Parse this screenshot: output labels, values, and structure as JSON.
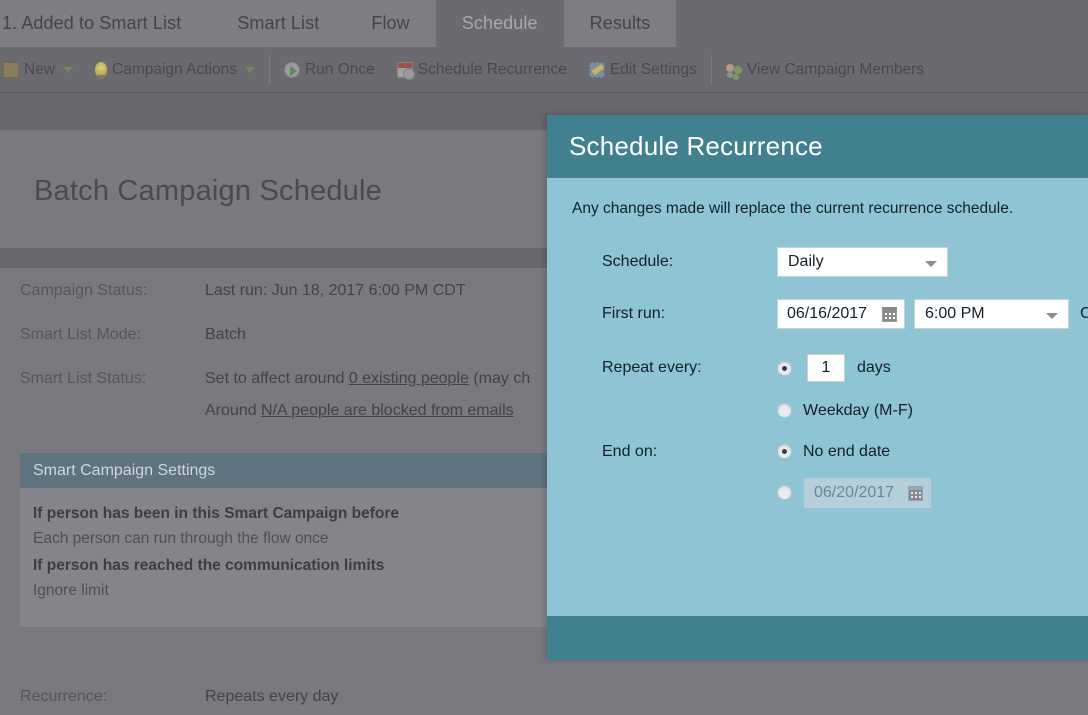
{
  "tabs": [
    {
      "label": "1. Added to Smart List",
      "active": false
    },
    {
      "label": "Smart List",
      "active": false
    },
    {
      "label": "Flow",
      "active": false
    },
    {
      "label": "Schedule",
      "active": true
    },
    {
      "label": "Results",
      "active": false
    }
  ],
  "toolbar": {
    "new_label": "New",
    "campaign_actions_label": "Campaign Actions",
    "run_once_label": "Run Once",
    "schedule_recurrence_label": "Schedule Recurrence",
    "edit_settings_label": "Edit Settings",
    "view_campaign_members_label": "View Campaign Members"
  },
  "page": {
    "title": "Batch Campaign Schedule",
    "rows": [
      {
        "label": "Campaign Status:",
        "value": "Last run: Jun 18, 2017 6:00 PM CDT"
      },
      {
        "label": "Smart List Mode:",
        "value": "Batch"
      }
    ],
    "smart_list_status": {
      "label": "Smart List Status:",
      "prefix": "Set to affect around ",
      "link": "0 existing people",
      "suffix": " (may ch",
      "sub_prefix": "Around ",
      "sub_link": "N/A people are blocked from emails"
    },
    "settings_panel": {
      "header": "Smart Campaign Settings",
      "items": [
        {
          "text": "If person has been in this Smart Campaign before",
          "bold": true
        },
        {
          "text": "Each person can run through the flow once",
          "bold": false
        },
        {
          "text": "If person has reached the communication limits",
          "bold": true
        },
        {
          "text": "Ignore limit",
          "bold": false
        }
      ]
    },
    "recurrence": {
      "label": "Recurrence:",
      "value": "Repeats every day"
    }
  },
  "modal": {
    "title": "Schedule Recurrence",
    "note": "Any changes made will replace the current recurrence schedule.",
    "schedule": {
      "label": "Schedule:",
      "value": "Daily",
      "options": [
        "Daily"
      ]
    },
    "first_run": {
      "label": "First run:",
      "date": "06/16/2017",
      "time": "6:00 PM",
      "timezone": "CDT"
    },
    "repeat_every": {
      "label": "Repeat every:",
      "interval_selected": true,
      "interval_value": "1",
      "interval_unit": "days",
      "weekday_selected": false,
      "weekday_label": "Weekday (M-F)"
    },
    "end_on": {
      "label": "End on:",
      "no_end_date_selected": true,
      "no_end_date_label": "No end date",
      "end_date_selected": false,
      "end_date_value": "06/20/2017"
    }
  },
  "colors": {
    "modal_header": "#41808f",
    "modal_body": "#8ec4d4",
    "panel_header": "#5f7280",
    "page_bg": "#7a7980"
  }
}
